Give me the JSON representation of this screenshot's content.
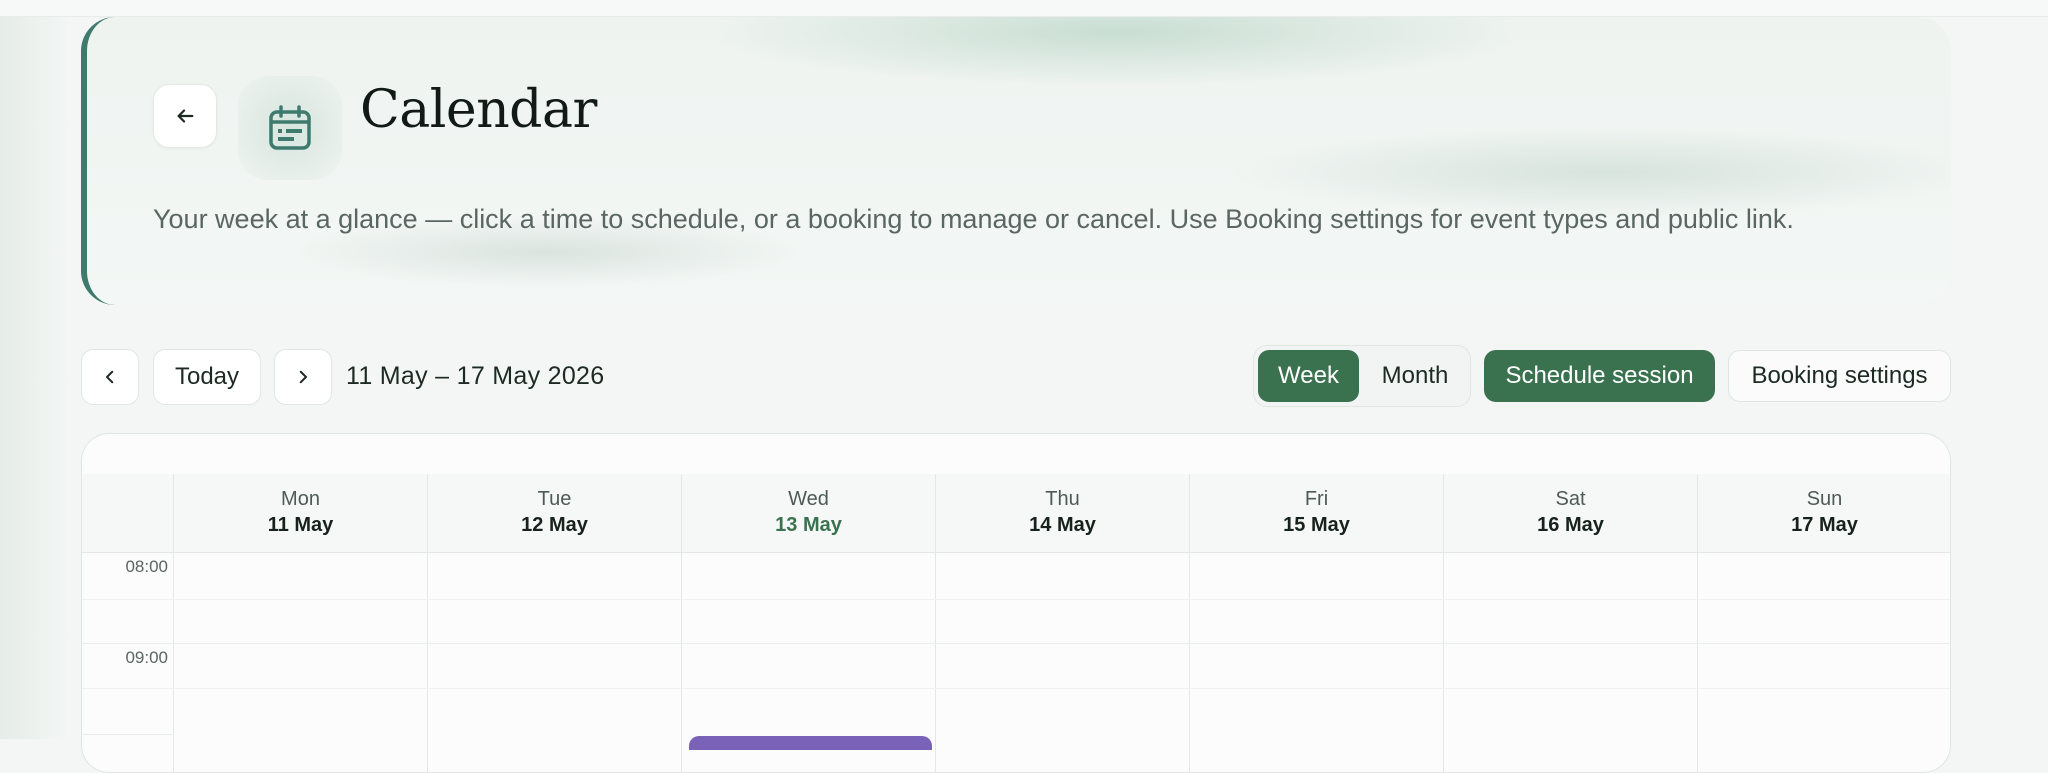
{
  "header": {
    "title": "Calendar",
    "subtitle": "Your week at a glance — click a time to schedule, or a booking to manage or cancel. Use Booking settings for event types and public link.",
    "back_icon": "arrow-left-icon",
    "calendar_icon": "calendar-icon"
  },
  "toolbar": {
    "prev_icon": "chevron-left-icon",
    "today_label": "Today",
    "next_icon": "chevron-right-icon",
    "range_label": "11 May – 17 May 2026",
    "view_week_label": "Week",
    "view_month_label": "Month",
    "active_view": "Week",
    "schedule_label": "Schedule session",
    "settings_label": "Booking settings"
  },
  "calendar": {
    "days": [
      {
        "name": "Mon",
        "date": "11 May",
        "today": false
      },
      {
        "name": "Tue",
        "date": "12 May",
        "today": false
      },
      {
        "name": "Wed",
        "date": "13 May",
        "today": true
      },
      {
        "name": "Thu",
        "date": "14 May",
        "today": false
      },
      {
        "name": "Fri",
        "date": "15 May",
        "today": false
      },
      {
        "name": "Sat",
        "date": "16 May",
        "today": false
      },
      {
        "name": "Sun",
        "date": "17 May",
        "today": false
      }
    ],
    "hours": [
      "08:00",
      "09:00"
    ],
    "event_color": "#7a62b8"
  },
  "colors": {
    "accent": "#3a7250",
    "today_text": "#3a7250",
    "hero_border": "#3f7a6e"
  }
}
